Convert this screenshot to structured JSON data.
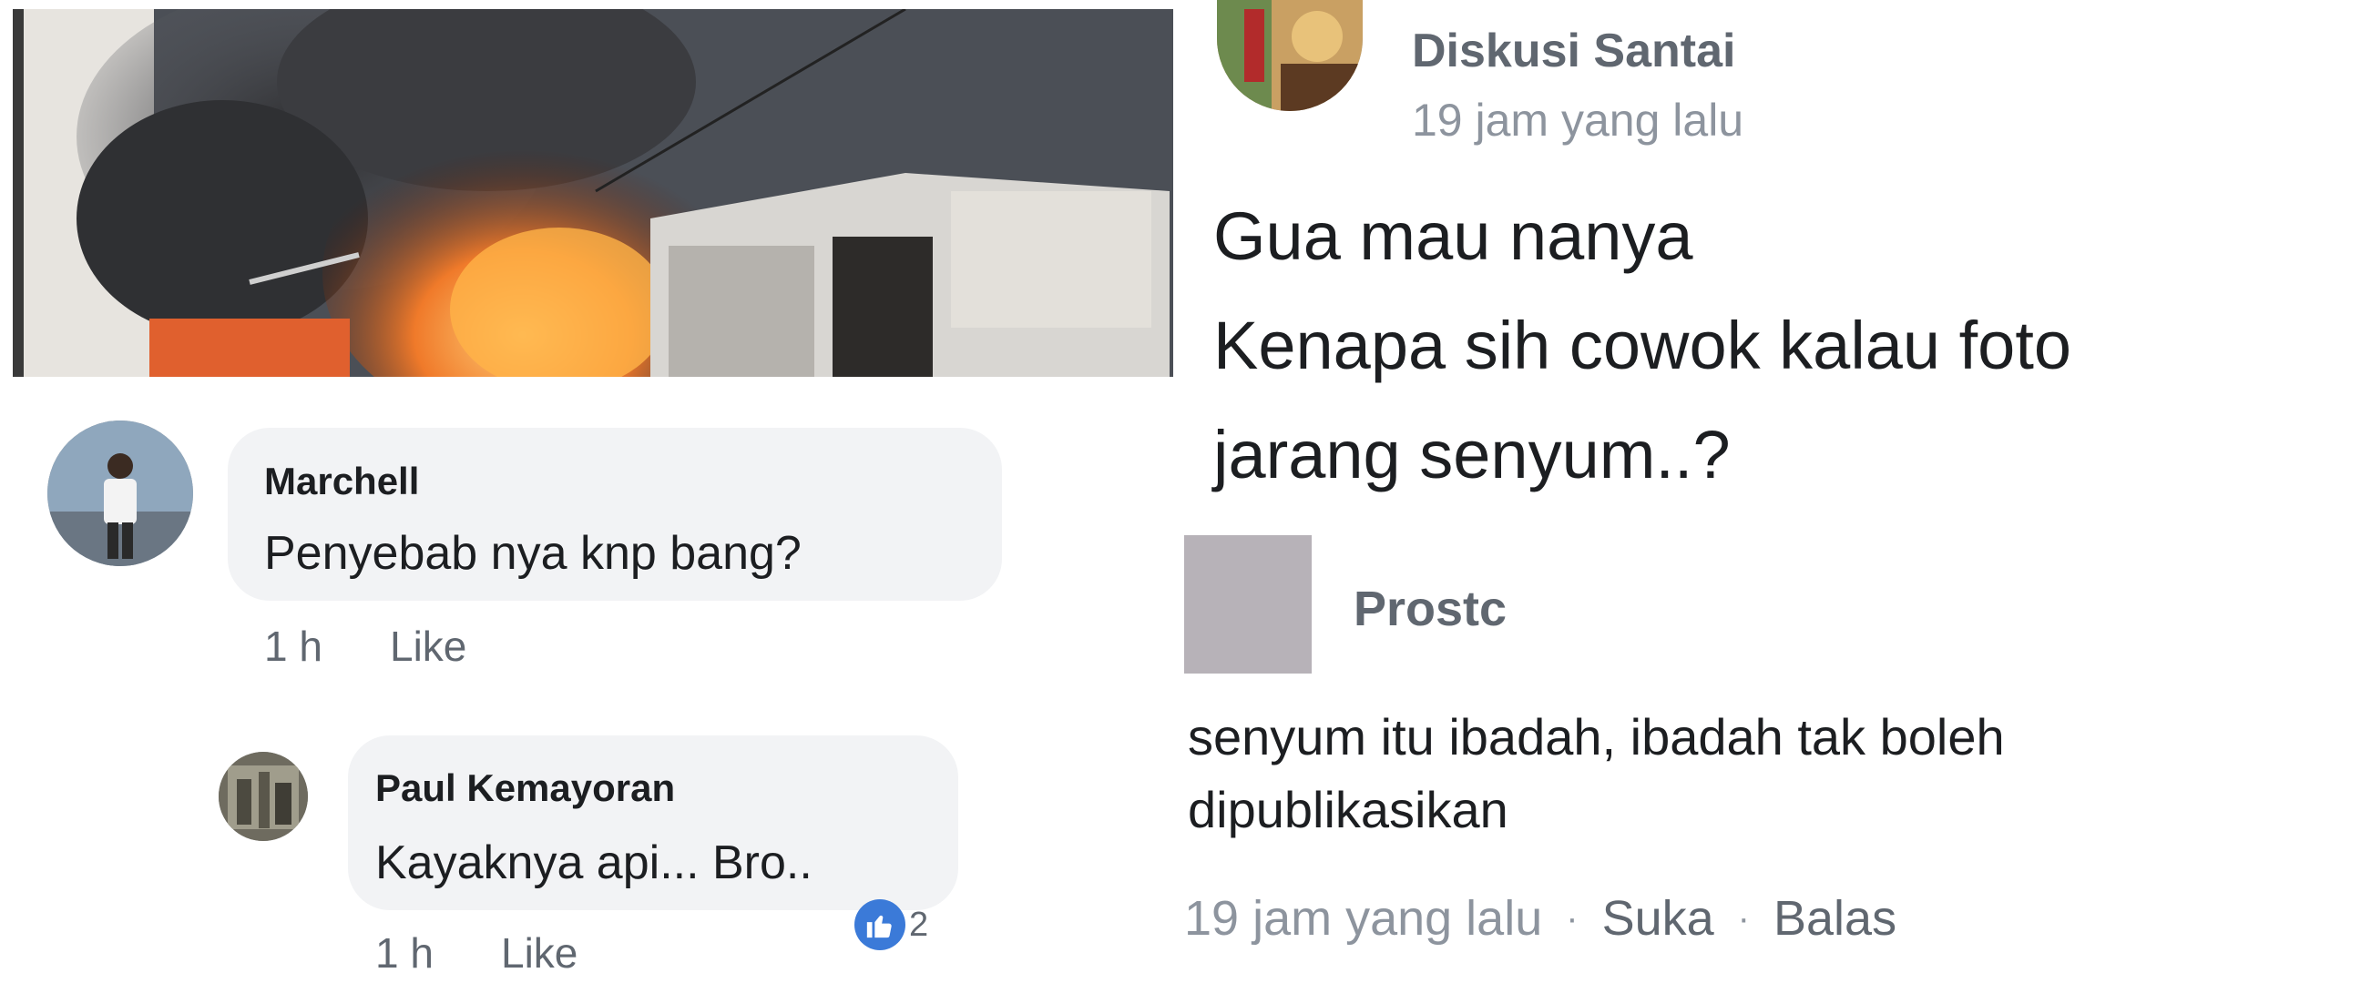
{
  "left": {
    "comments": [
      {
        "name": "Marchell",
        "text": "Penyebab nya knp bang?",
        "time": "1 h",
        "like": "Like"
      },
      {
        "name": "Paul Kemayoran",
        "text": "Kayaknya api... Bro..",
        "time": "1 h",
        "like": "Like",
        "reaction_count": "2"
      }
    ]
  },
  "right": {
    "group_name": "Diskusi Santai",
    "post_time": "19 jam yang lalu",
    "post_lines": [
      "Gua mau nanya",
      "Kenapa sih cowok kalau foto",
      "jarang senyum..?"
    ],
    "reply": {
      "name": "Prostc",
      "lines": [
        "senyum itu ibadah, ibadah tak boleh",
        "dipublikasikan"
      ],
      "time": "19 jam yang lalu",
      "like": "Suka",
      "reply_action": "Balas"
    }
  },
  "colors": {
    "reaction_blue": "#3b7ad8",
    "bubble_bg": "#f2f3f5",
    "meta_gray": "#606770"
  },
  "icons": [
    "like-reaction-icon"
  ]
}
